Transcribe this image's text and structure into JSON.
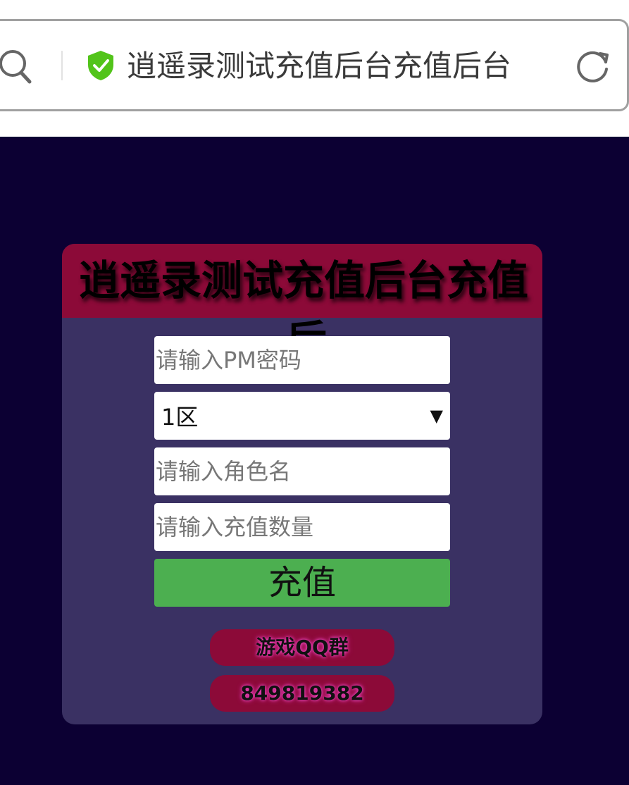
{
  "browser": {
    "url_text": "逍遥录测试充值后台充值后台",
    "colors": {
      "shield": "#52c41a",
      "border": "#a0a0a0"
    },
    "icons": {
      "search": "search-icon",
      "secure": "shield-check-icon",
      "reload": "reload-icon"
    }
  },
  "panel": {
    "title": "逍遥录测试充值后台充值",
    "title_overflow": "后台",
    "fields": {
      "pm_password_placeholder": "请输入PM密码",
      "zone_value": "1区",
      "zone_caret": "▼",
      "role_placeholder": "请输入角色名",
      "amount_placeholder": "请输入充值数量"
    },
    "submit_label": "充值",
    "group_label": "游戏QQ群",
    "group_number": "849819382"
  },
  "colors": {
    "page_bg": "#0c0033",
    "panel_bg": "#3a3163",
    "header_bg": "#8c0a38",
    "submit_bg": "#4caf50",
    "pill_bg": "#8c0a38"
  }
}
